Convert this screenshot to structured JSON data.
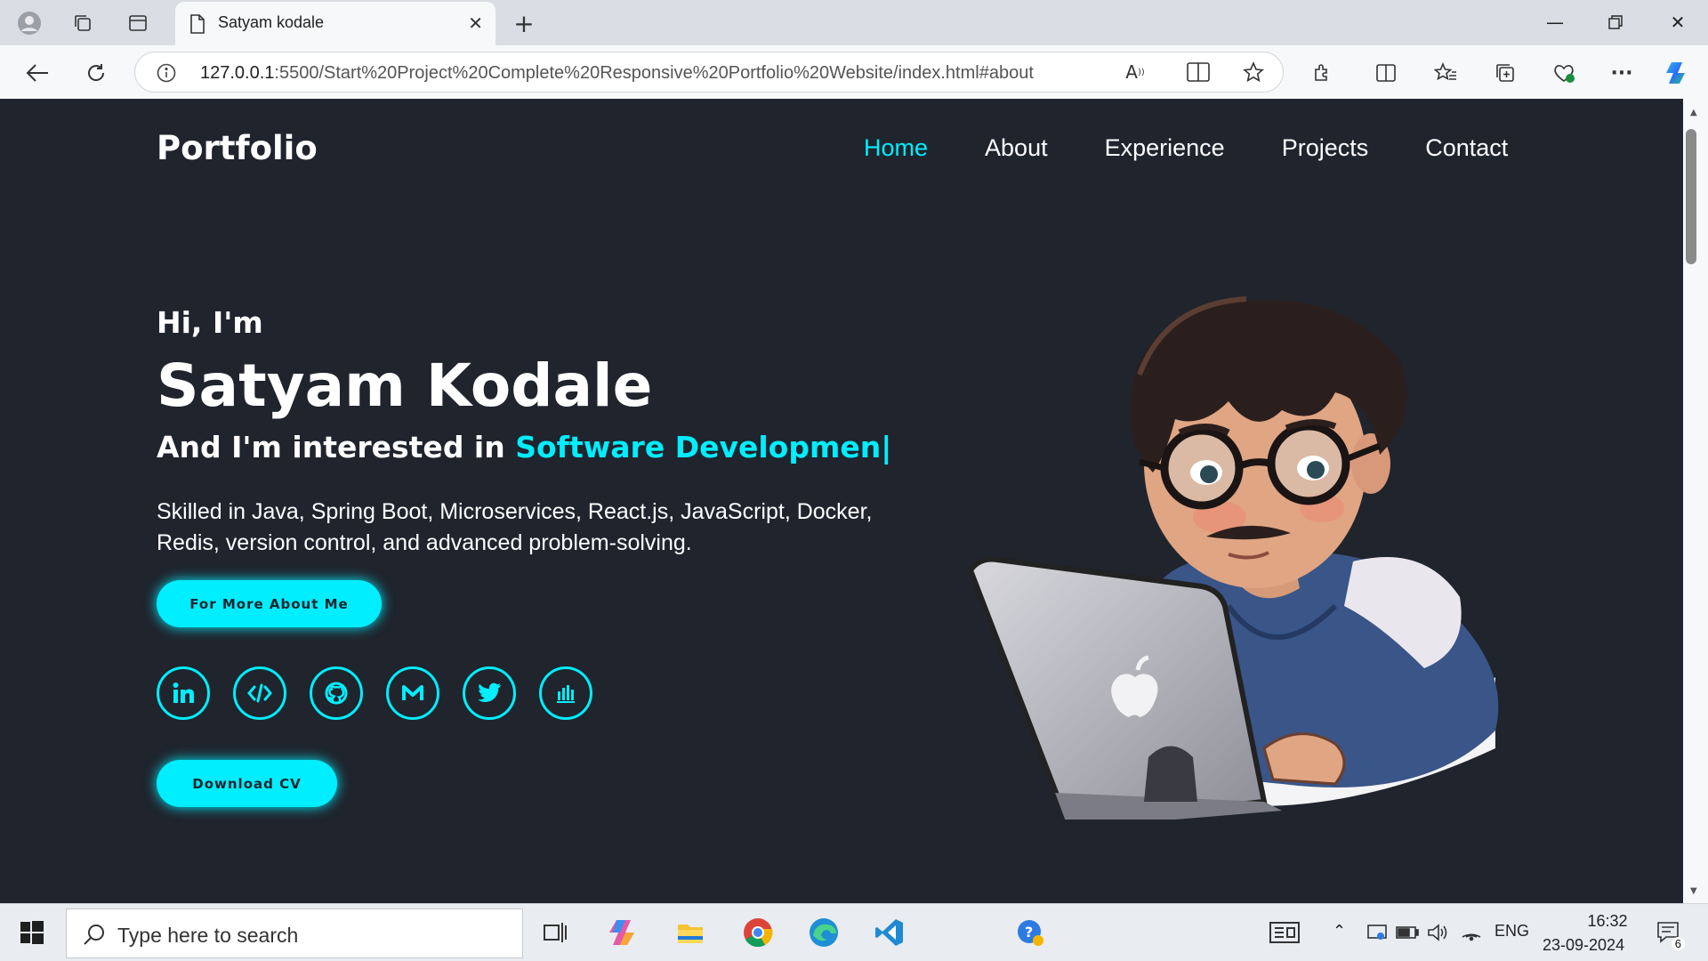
{
  "browser": {
    "tab_title": "Satyam kodale",
    "url_host": "127.0.0.1",
    "url_rest": ":5500/Start%20Project%20Complete%20Responsive%20Portfolio%20Website/index.html#about"
  },
  "site": {
    "logo": "Portfolio",
    "nav": [
      "Home",
      "About",
      "Experience",
      "Projects",
      "Contact"
    ],
    "active_nav": "Home",
    "greeting": "Hi, I'm",
    "name": "Satyam Kodale",
    "interest_prefix": "And I'm interested in ",
    "interest_typed": "Software Developmen|",
    "description": "Skilled in Java, Spring Boot, Microservices, React.js, JavaScript, Docker, Redis, version control, and advanced problem-solving.",
    "more_button": "For More About Me",
    "cv_button": "Download CV",
    "socials": [
      "linkedin-icon",
      "code-icon",
      "github-icon",
      "gmail-icon",
      "twitter-icon",
      "chart-icon"
    ],
    "accent": "#00eeff",
    "background": "#1f242d"
  },
  "taskbar": {
    "search_placeholder": "Type here to search",
    "language": "ENG",
    "time": "16:32",
    "date": "23-09-2024",
    "notifications": "6"
  }
}
